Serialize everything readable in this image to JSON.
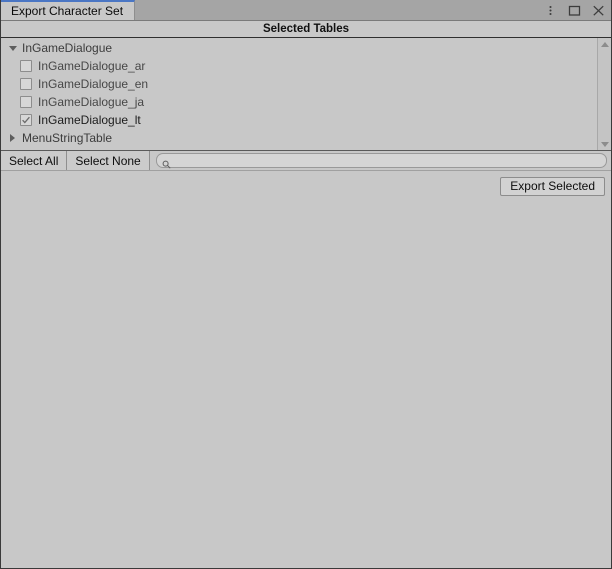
{
  "window": {
    "accent_color": "#4a76c4",
    "background_color": "#c8c8c8",
    "tabbar_color": "#a5a5a5"
  },
  "tab": {
    "label": "Export Character Set"
  },
  "window_controls": [
    {
      "name": "kebab-menu-icon",
      "label": "⋮"
    },
    {
      "name": "maximize-icon",
      "label": "☐"
    },
    {
      "name": "close-icon",
      "label": "✕"
    }
  ],
  "header": {
    "title": "Selected Tables"
  },
  "tree": {
    "items": [
      {
        "label": "InGameDialogue",
        "type": "group",
        "expanded": true,
        "foldout": "triangle-down"
      },
      {
        "label": "InGameDialogue_ar",
        "type": "leaf",
        "checked": false
      },
      {
        "label": "InGameDialogue_en",
        "type": "leaf",
        "checked": false
      },
      {
        "label": "InGameDialogue_ja",
        "type": "leaf",
        "checked": false
      },
      {
        "label": "InGameDialogue_lt",
        "type": "leaf",
        "checked": true
      },
      {
        "label": "MenuStringTable",
        "type": "group",
        "expanded": false,
        "foldout": "triangle-right"
      }
    ]
  },
  "scrollbar": {
    "up_arrow": "scroll-up-arrow",
    "down_arrow": "scroll-down-arrow"
  },
  "toolbar": {
    "select_all_label": "Select All",
    "select_none_label": "Select None",
    "search": {
      "value": "",
      "placeholder": "",
      "icon": "search-icon"
    }
  },
  "actions": {
    "export_label": "Export Selected"
  }
}
